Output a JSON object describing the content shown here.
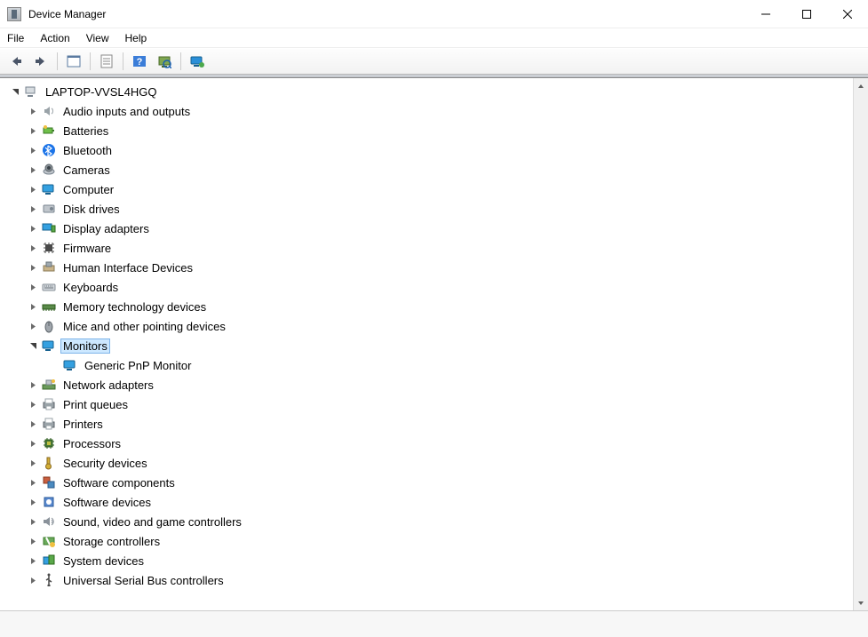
{
  "window": {
    "title": "Device Manager"
  },
  "menu": {
    "items": [
      "File",
      "Action",
      "View",
      "Help"
    ]
  },
  "toolbar": {
    "back": "Back",
    "forward": "Forward",
    "showhide": "Show/Hide Console Tree",
    "properties": "Properties",
    "help": "Help",
    "scan": "Scan for hardware changes",
    "monitor_action": "Add legacy hardware"
  },
  "tree": {
    "root": {
      "label": "LAPTOP-VVSL4HGQ",
      "icon": "computer-root"
    },
    "categories": [
      {
        "label": "Audio inputs and outputs",
        "icon": "speaker"
      },
      {
        "label": "Batteries",
        "icon": "battery"
      },
      {
        "label": "Bluetooth",
        "icon": "bluetooth"
      },
      {
        "label": "Cameras",
        "icon": "camera"
      },
      {
        "label": "Computer",
        "icon": "monitor"
      },
      {
        "label": "Disk drives",
        "icon": "disk"
      },
      {
        "label": "Display adapters",
        "icon": "display-adapter"
      },
      {
        "label": "Firmware",
        "icon": "chip"
      },
      {
        "label": "Human Interface Devices",
        "icon": "hid"
      },
      {
        "label": "Keyboards",
        "icon": "keyboard"
      },
      {
        "label": "Memory technology devices",
        "icon": "memory"
      },
      {
        "label": "Mice and other pointing devices",
        "icon": "mouse"
      },
      {
        "label": "Monitors",
        "icon": "monitor",
        "expanded": true,
        "selected": true,
        "children": [
          {
            "label": "Generic PnP Monitor",
            "icon": "monitor"
          }
        ]
      },
      {
        "label": "Network adapters",
        "icon": "network"
      },
      {
        "label": "Print queues",
        "icon": "printer"
      },
      {
        "label": "Printers",
        "icon": "printer"
      },
      {
        "label": "Processors",
        "icon": "cpu"
      },
      {
        "label": "Security devices",
        "icon": "security"
      },
      {
        "label": "Software components",
        "icon": "software-component"
      },
      {
        "label": "Software devices",
        "icon": "software-device"
      },
      {
        "label": "Sound, video and game controllers",
        "icon": "sound"
      },
      {
        "label": "Storage controllers",
        "icon": "storage"
      },
      {
        "label": "System devices",
        "icon": "system"
      },
      {
        "label": "Universal Serial Bus controllers",
        "icon": "usb"
      }
    ]
  }
}
